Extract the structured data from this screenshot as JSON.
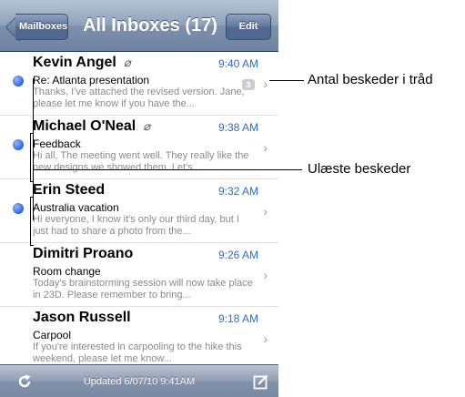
{
  "navbar": {
    "back_label": "Mailboxes",
    "title": "All Inboxes (17)",
    "edit_label": "Edit"
  },
  "messages": [
    {
      "sender": "Kevin Angel",
      "attachment": true,
      "time": "9:40 AM",
      "subject": "Re: Atlanta presentation",
      "preview": "Thanks, I've attached the revised version. Jane, please let me know if you have the...",
      "unread": true,
      "thread_count": "3"
    },
    {
      "sender": "Michael O'Neal",
      "attachment": true,
      "time": "9:38 AM",
      "subject": "Feedback",
      "preview": "Hi all, The meeting went well. They really like the new designs we showed them. Let's...",
      "unread": true,
      "thread_count": ""
    },
    {
      "sender": "Erin Steed",
      "attachment": false,
      "time": "9:32 AM",
      "subject": "Australia vacation",
      "preview": "Hi everyone, I know it's only our third day, but I just had to share a photo from the...",
      "unread": true,
      "thread_count": ""
    },
    {
      "sender": "Dimitri Proano",
      "attachment": false,
      "time": "9:26 AM",
      "subject": "Room change",
      "preview": "Today's brainstorming session will now take place in 23D. Please remember to bring...",
      "unread": false,
      "thread_count": ""
    },
    {
      "sender": "Jason Russell",
      "attachment": false,
      "time": "9:18 AM",
      "subject": "Carpool",
      "preview": "If you're interested in carpooling to the hike this weekend, please let me know...",
      "unread": false,
      "thread_count": ""
    }
  ],
  "toolbar": {
    "updated_text": "Updated 6/07/10 9:41AM"
  },
  "callouts": {
    "thread_count_label": "Antal beskeder i tråd",
    "unread_label": "Ulæste beskeder"
  },
  "colors": {
    "unread_dot": "#2d64d8",
    "time": "#2a6ed8",
    "navbar": "#7d90ac"
  },
  "icons": {
    "attachment": "paperclip-icon",
    "refresh": "refresh-icon",
    "compose": "compose-icon",
    "chevron": "chevron-right-icon"
  }
}
